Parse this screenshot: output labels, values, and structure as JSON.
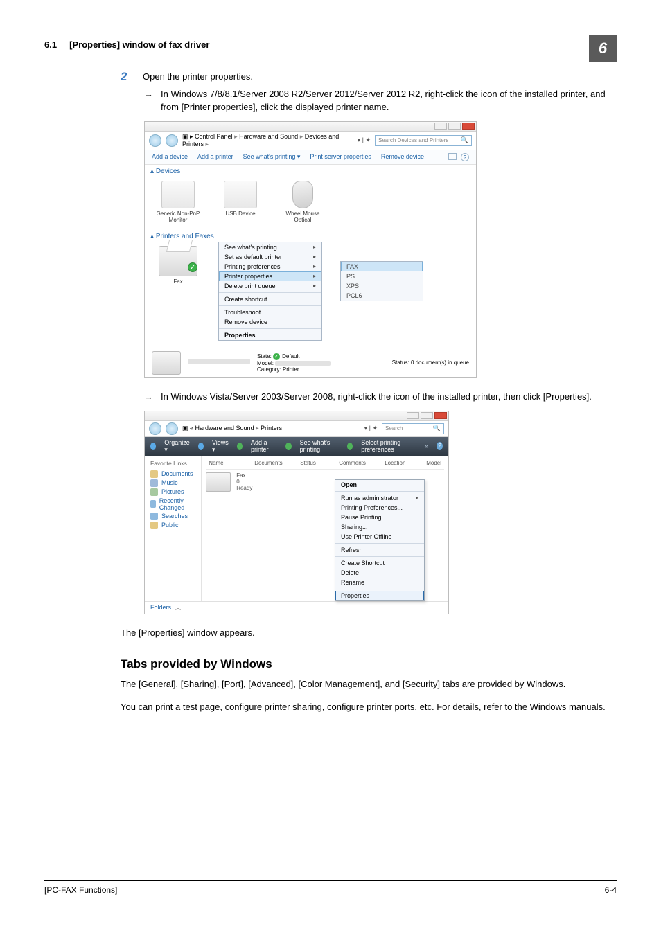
{
  "header": {
    "section_no": "6.1",
    "section_title": "[Properties] window of fax driver",
    "chapter_no": "6"
  },
  "step2": {
    "number": "2",
    "text": "Open the printer properties.",
    "bullet_a": "In Windows 7/8/8.1/Server 2008 R2/Server 2012/Server 2012 R2, right-click the icon of the installed printer, and from [Printer properties], click the displayed printer name.",
    "bullet_b": "In Windows Vista/Server 2003/Server 2008, right-click the icon of the installed printer, then click [Properties]."
  },
  "ss1": {
    "breadcrumb": [
      "Control Panel",
      "Hardware and Sound",
      "Devices and Printers"
    ],
    "search_placeholder": "Search Devices and Printers",
    "toolbar": [
      "Add a device",
      "Add a printer",
      "See what's printing",
      "Print server properties",
      "Remove device"
    ],
    "section_devices": "Devices",
    "devices": [
      {
        "name": "Generic Non-PnP Monitor"
      },
      {
        "name": "USB Device"
      },
      {
        "name": "Wheel Mouse Optical"
      }
    ],
    "section_printers": "Printers and Faxes",
    "printer_name": "Fax",
    "context_menu": [
      "See what's printing",
      "Set as default printer",
      "Printing preferences",
      "Printer properties",
      "Delete print queue",
      "Create shortcut",
      "Troubleshoot",
      "Remove device",
      "Properties"
    ],
    "submenu": [
      "FAX",
      "PS",
      "XPS",
      "PCL6"
    ],
    "status": {
      "state_label": "State:",
      "state_value": "Default",
      "model_label": "Model:",
      "category_label": "Category:",
      "category_value": "Printer",
      "status_label": "Status:",
      "status_value": "0 document(s) in queue"
    }
  },
  "ss2": {
    "breadcrumb": [
      "Hardware and Sound",
      "Printers"
    ],
    "search_placeholder": "Search",
    "toolbar": [
      "Organize",
      "Views",
      "Add a printer",
      "See what's printing",
      "Select printing preferences"
    ],
    "nav_header": "Favorite Links",
    "nav_items": [
      "Documents",
      "Music",
      "Pictures",
      "Recently Changed",
      "Searches",
      "Public"
    ],
    "columns": [
      "Name",
      "Documents",
      "Status",
      "Comments",
      "Location",
      "Model"
    ],
    "printer": {
      "name": "Fax",
      "docs": "0",
      "status": "Ready"
    },
    "context_menu": [
      "Open",
      "Run as administrator",
      "Printing Preferences...",
      "Pause Printing",
      "Sharing...",
      "Use Printer Offline",
      "Refresh",
      "Create Shortcut",
      "Delete",
      "Rename",
      "Properties"
    ],
    "folders_label": "Folders"
  },
  "post_text": "The [Properties] window appears.",
  "tabs_heading": "Tabs provided by Windows",
  "tabs_para1": "The [General], [Sharing], [Port], [Advanced], [Color Management], and [Security] tabs are provided by Windows.",
  "tabs_para2": "You can print a test page, configure printer sharing, configure printer ports, etc. For details, refer to the Windows manuals.",
  "footer": {
    "left": "[PC-FAX Functions]",
    "right": "6-4"
  }
}
